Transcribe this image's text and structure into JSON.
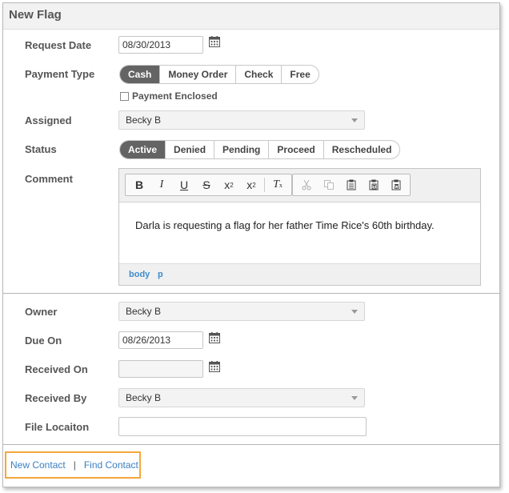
{
  "form": {
    "title": "New Flag",
    "request_date": {
      "label": "Request Date",
      "value": "08/30/2013"
    },
    "payment_type": {
      "label": "Payment Type",
      "options": [
        "Cash",
        "Money Order",
        "Check",
        "Free"
      ],
      "selected": "Cash"
    },
    "payment_enclosed": {
      "label": "Payment Enclosed",
      "checked": false
    },
    "assigned": {
      "label": "Assigned",
      "value": "Becky B"
    },
    "status": {
      "label": "Status",
      "options": [
        "Active",
        "Denied",
        "Pending",
        "Proceed",
        "Rescheduled"
      ],
      "selected": "Active"
    },
    "comment": {
      "label": "Comment",
      "content": "Darla is requesting a flag for her father Time Rice's 60th birthday.",
      "path": [
        "body",
        "p"
      ]
    },
    "owner": {
      "label": "Owner",
      "value": "Becky B"
    },
    "due_on": {
      "label": "Due On",
      "value": "08/26/2013"
    },
    "received_on": {
      "label": "Received On",
      "value": ""
    },
    "received_by": {
      "label": "Received By",
      "value": "Becky B"
    },
    "file_location": {
      "label": "File Locaiton",
      "value": ""
    }
  },
  "footer": {
    "new_contact": "New Contact",
    "separator": "|",
    "find_contact": "Find Contact"
  },
  "icons": {
    "calendar": "calendar-icon",
    "toolbar": [
      "bold-icon",
      "italic-icon",
      "underline-icon",
      "strikethrough-icon",
      "subscript-icon",
      "superscript-icon",
      "remove-format-icon",
      "cut-icon",
      "copy-icon",
      "paste-icon",
      "paste-text-icon",
      "paste-word-icon"
    ]
  },
  "colors": {
    "selected_segment": "#646464",
    "link": "#3a7fc4",
    "highlight_border": "#f4a73b"
  }
}
